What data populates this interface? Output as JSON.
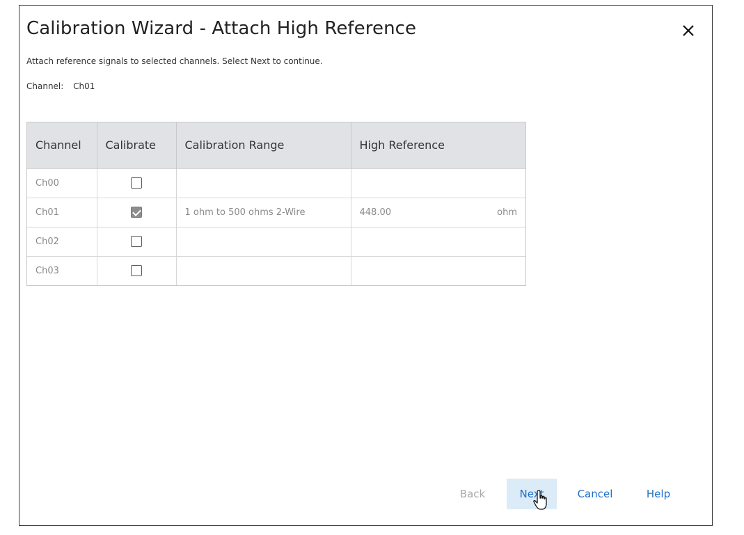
{
  "dialog": {
    "title": "Calibration Wizard -  Attach High Reference",
    "instruction": "Attach reference signals to selected channels. Select Next to continue.",
    "channel_label": "Channel:",
    "channel_value": "Ch01"
  },
  "table": {
    "columns": [
      "Channel",
      "Calibrate",
      "Calibration Range",
      "High Reference"
    ],
    "rows": [
      {
        "channel": "Ch00",
        "calibrate": false,
        "range": "",
        "high_ref": "",
        "unit": ""
      },
      {
        "channel": "Ch01",
        "calibrate": true,
        "range": "1 ohm to 500 ohms 2-Wire",
        "high_ref": "448.00",
        "unit": "ohm"
      },
      {
        "channel": "Ch02",
        "calibrate": false,
        "range": "",
        "high_ref": "",
        "unit": ""
      },
      {
        "channel": "Ch03",
        "calibrate": false,
        "range": "",
        "high_ref": "",
        "unit": ""
      }
    ]
  },
  "buttons": {
    "back": "Back",
    "next": "Next",
    "cancel": "Cancel",
    "help": "Help"
  },
  "icons": {
    "close": "close-icon",
    "cursor": "hand-pointer-cursor"
  },
  "colors": {
    "accent": "#1e6fc8",
    "next_bg": "#dcebf8",
    "header_bg": "#e0e2e5",
    "disabled": "#a8a8a8"
  }
}
